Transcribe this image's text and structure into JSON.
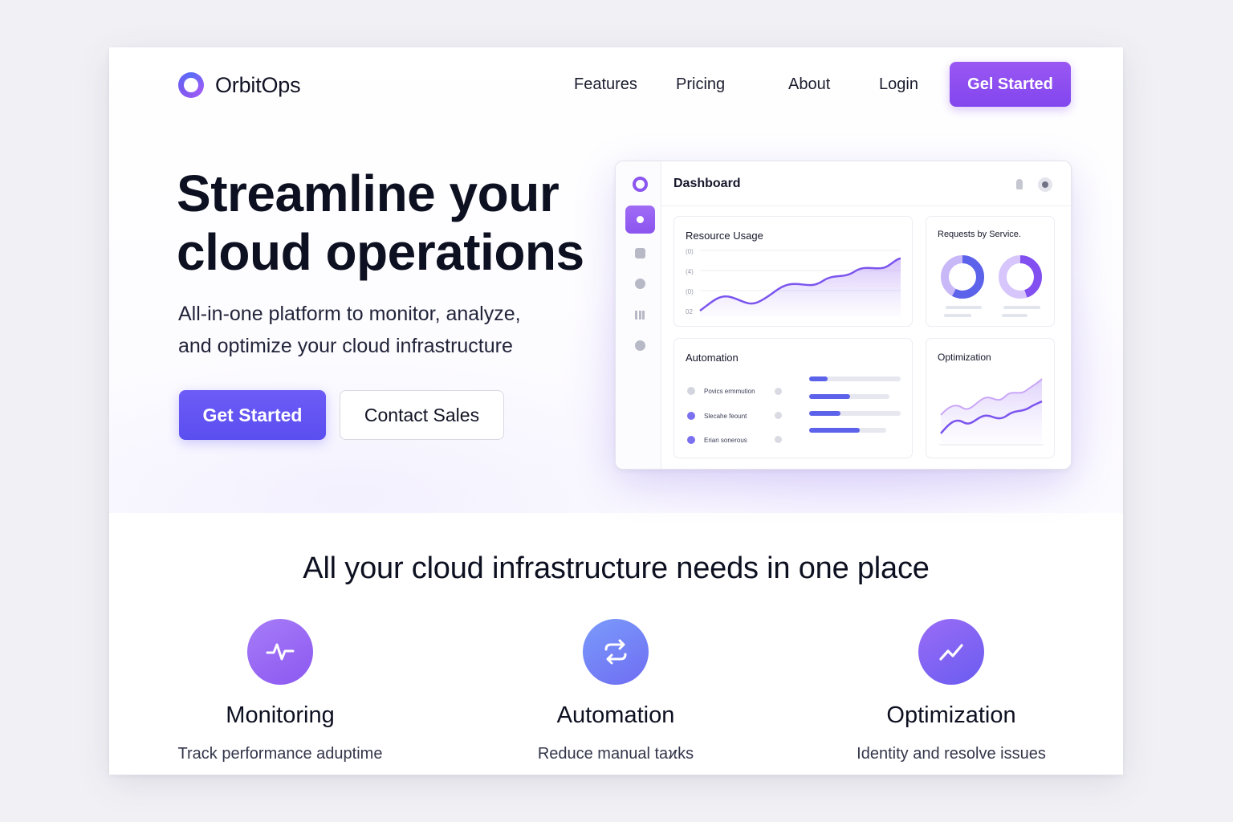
{
  "nav": {
    "brand": "OrbitOps",
    "links": [
      "Features",
      "Pricing",
      "About",
      "Login"
    ],
    "cta": "Gel Started"
  },
  "hero": {
    "title_line1": "Streamline your",
    "title_line2": "cloud operations",
    "subtitle_line1": "All-in-one platform to monitor, analyze,",
    "subtitle_line2": "and optimize your cloud infrastructure",
    "primary_button": "Get Started",
    "secondary_button": "Contact Sales"
  },
  "dashboard": {
    "title": "Dashboard",
    "resource_usage": {
      "title": "Resource Usage",
      "ticks": [
        "(0)",
        "(4)",
        "(0)",
        "02"
      ]
    },
    "requests": {
      "title": "Requests by Service."
    },
    "automation": {
      "title": "Automation",
      "rows": [
        {
          "label": "Povics ermmution",
          "dot_color": "#d3d5de",
          "bar_primary": 0.27,
          "bar_secondary": 0.73
        },
        {
          "label": "Slecahe feount",
          "dot_color": "#7a70f0",
          "bar_primary": 0.44,
          "bar_secondary": 0.86
        },
        {
          "label": "Erian sonerous",
          "dot_color": "#7a70f0",
          "bar_primary": 0.33,
          "bar_secondary": 0.78
        },
        {
          "label": "",
          "dot_color": "",
          "bar_primary": 0.55,
          "bar_secondary": 0.84
        }
      ]
    },
    "optimization": {
      "title": "Optimization"
    },
    "colors": {
      "accent": "#8b55f0",
      "indigo": "#5c63ea"
    }
  },
  "features": {
    "heading": "All your cloud infrastructure needs in one place",
    "items": [
      {
        "name": "Monitoring",
        "desc": "Track performance aduptime",
        "icon": "pulse-icon"
      },
      {
        "name": "Automation",
        "desc": "Reduce manual taϰks",
        "icon": "sync-arrows-icon"
      },
      {
        "name": "Optimization",
        "desc": "Identity and resolve issues",
        "icon": "trend-up-icon"
      }
    ]
  }
}
